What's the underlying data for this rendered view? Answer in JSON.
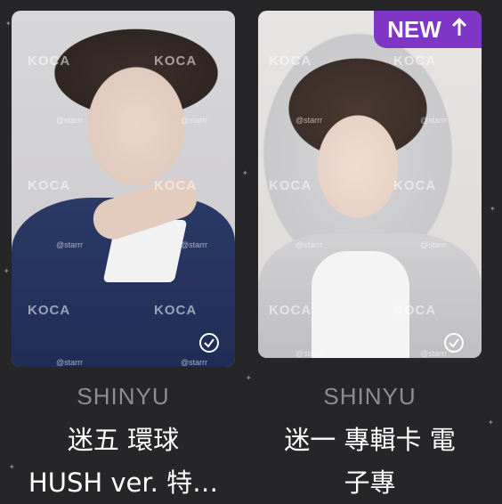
{
  "cards": [
    {
      "member": "SHINYU",
      "title_lines": [
        "迷五 環球",
        "HUSH ver. 特…"
      ],
      "watermark": "KOCA",
      "credit": "@starrr",
      "owned": true
    },
    {
      "member": "SHINYU",
      "title_lines": [
        "迷一 專輯卡 電",
        "子專"
      ],
      "watermark": "KOCA",
      "credit": "@starrr",
      "owned": true,
      "badge": {
        "label": "NEW",
        "icon": "arrow-up-icon"
      }
    }
  ],
  "colors": {
    "background": "#262528",
    "badge": "#7f35c6",
    "member_text": "#8f8d92",
    "title_text": "#ffffff"
  }
}
